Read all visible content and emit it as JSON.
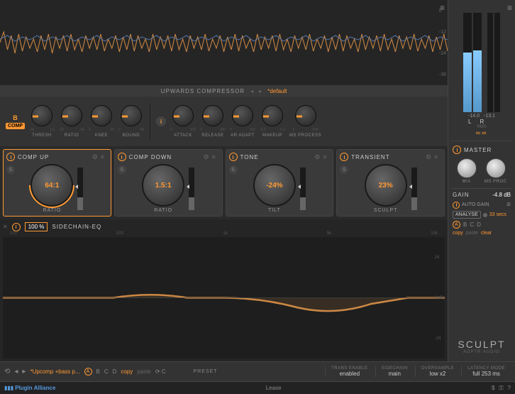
{
  "waveform_scale": [
    "0",
    "-12",
    "-24",
    "-36"
  ],
  "comp_header": {
    "title": "UPWARDS COMPRESSOR",
    "preset": "*default"
  },
  "detail": {
    "badge_b": "B",
    "comp_tag": "COMP",
    "knobs": [
      {
        "label": "THRESH",
        "range": [
          "-16",
          "1.2"
        ]
      },
      {
        "label": "RATIO",
        "range": [
          "-31",
          "64"
        ]
      },
      {
        "label": "KNEE",
        "range": [
          "0",
          "24"
        ]
      },
      {
        "label": "BOUND",
        "range": [
          "0",
          "96"
        ]
      },
      {
        "label": "ATTACK",
        "range": [
          "0",
          "100"
        ]
      },
      {
        "label": "RELEASE",
        "range": [
          "0",
          "100"
        ]
      },
      {
        "label": "AR ADAPT",
        "range": [
          "0",
          "100"
        ]
      },
      {
        "label": "MAKEUP",
        "range": [
          "-6.0",
          "6.0"
        ]
      },
      {
        "label": "MS PROCESS",
        "range": [
          "0",
          "100"
        ]
      }
    ]
  },
  "modules": {
    "comp_up": {
      "title": "COMP UP",
      "value": "64:1",
      "label": "RATIO"
    },
    "comp_down": {
      "title": "COMP DOWN",
      "value": "1.5:1",
      "label": "RATIO"
    },
    "tone": {
      "title": "TONE",
      "value": "-24%",
      "label": "TILT"
    },
    "transient": {
      "title": "TRANSIENT",
      "value": "23%",
      "label": "SCULPT"
    }
  },
  "sidechain": {
    "pct": "100 %",
    "title": "SIDECHAIN-EQ",
    "freqs": [
      "",
      "100",
      "500",
      "1k",
      "5k",
      "10k",
      ""
    ],
    "scale": [
      "24",
      "0 dB",
      "-24"
    ]
  },
  "meters": {
    "l_val": "-14.0",
    "r_val": "-13.1",
    "l_lbl": "L",
    "r_lbl": "R",
    "rms": "RMS",
    "inf": "∞∞"
  },
  "master": {
    "title": "MASTER",
    "mix_label": "MIX",
    "msproc_label": "MS PROC"
  },
  "gain": {
    "label": "GAIN",
    "value": "-4.8 dB",
    "auto_gain": "AUTO GAIN",
    "analyse": "ANALYSE",
    "secs": "33 secs",
    "a": "A",
    "b": "B",
    "c": "C",
    "d": "D",
    "copy": "copy",
    "paste": "paste",
    "clear": "clear"
  },
  "brand": {
    "sculpt": "SCULPT",
    "adptr": "ADPTR AUDIO"
  },
  "preset_bar": {
    "label": "PRESET",
    "name": "*Upcomp +bass p...",
    "a": "A",
    "b": "B",
    "c": "C",
    "d": "D",
    "copy": "copy",
    "paste": "paste",
    "sections": [
      {
        "label": "TRANS ENABLE",
        "val": "enabled"
      },
      {
        "label": "SIDECHAIN",
        "val": "main"
      },
      {
        "label": "OVERSAMPLE",
        "val": "low x2"
      },
      {
        "label": "LATENCY MODE",
        "val": "full 253 ms"
      }
    ]
  },
  "footer": {
    "pa": "Plugin Alliance",
    "center": "Lease"
  }
}
